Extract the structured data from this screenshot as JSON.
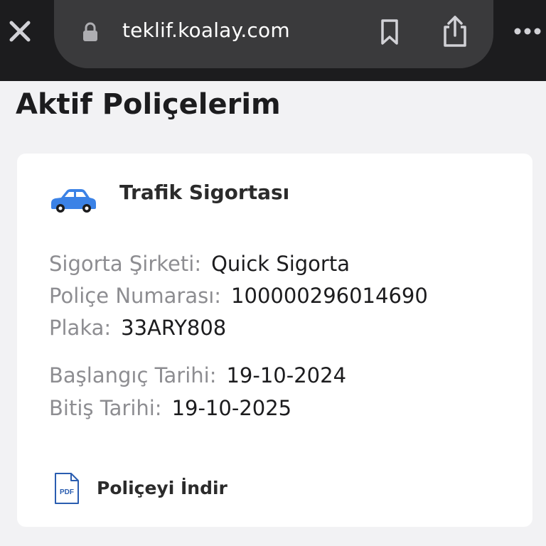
{
  "browser": {
    "url": "teklif.koalay.com"
  },
  "page": {
    "title": "Aktif Poliçelerim"
  },
  "policy": {
    "title": "Trafik Sigortası",
    "icon": "car-icon",
    "company_label": "Sigorta Şirketi:",
    "company_value": "Quick Sigorta",
    "number_label": "Poliçe Numarası:",
    "number_value": "100000296014690",
    "plate_label": "Plaka:",
    "plate_value": "33ARY808",
    "start_label": "Başlangıç Tarihi:",
    "start_value": "19-10-2024",
    "end_label": "Bitiş Tarihi:",
    "end_value": "19-10-2025",
    "download_label": "Poliçeyi İndir",
    "pdf_icon_text": "PDF"
  },
  "colors": {
    "browser_bar": "#1c1c1e",
    "url_pill": "#3a3a3c",
    "car_blue": "#3b82e6",
    "label_gray": "#8d8d91",
    "pdf_blue": "#2a5db0"
  }
}
